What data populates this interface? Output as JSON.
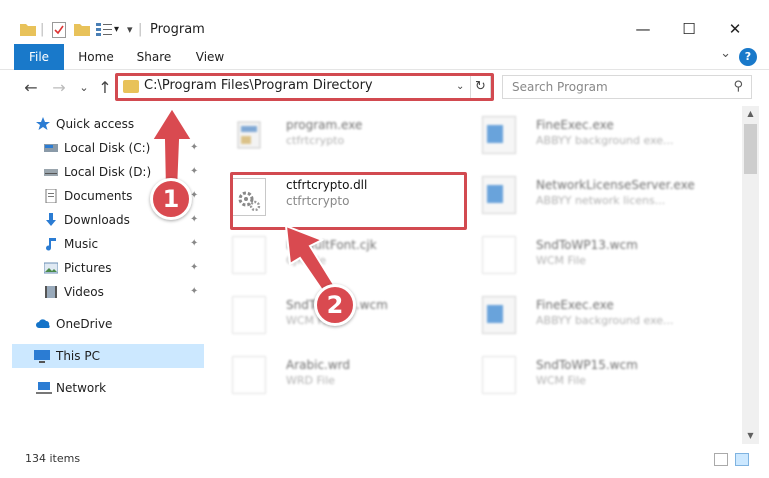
{
  "window": {
    "title": "Program",
    "minimize": "—",
    "maximize": "☐",
    "close": "✕"
  },
  "quick_access_toolbar": {
    "dropdown": "▾"
  },
  "ribbon": {
    "tabs": [
      {
        "label": "File"
      },
      {
        "label": "Home"
      },
      {
        "label": "Share"
      },
      {
        "label": "View"
      }
    ],
    "expand": "⌄",
    "help": "?"
  },
  "navigation": {
    "back": "←",
    "forward": "→",
    "recent": "⌄",
    "up": "↑",
    "address": "C:\\Program Files\\Program Directory",
    "address_dropdown": "⌄",
    "refresh": "↻",
    "search_placeholder": "Search Program"
  },
  "sidebar": {
    "items": [
      {
        "label": "Quick access",
        "icon": "star-icon"
      },
      {
        "label": "Local Disk (C:)",
        "icon": "drive-icon",
        "pinned": true
      },
      {
        "label": "Local Disk (D:)",
        "icon": "drive-icon",
        "pinned": true
      },
      {
        "label": "Documents",
        "icon": "documents-icon",
        "pinned": true
      },
      {
        "label": "Downloads",
        "icon": "downloads-icon",
        "pinned": true
      },
      {
        "label": "Music",
        "icon": "music-icon",
        "pinned": true
      },
      {
        "label": "Pictures",
        "icon": "pictures-icon",
        "pinned": true
      },
      {
        "label": "Videos",
        "icon": "videos-icon",
        "pinned": true
      },
      {
        "label": "OneDrive",
        "icon": "onedrive-icon"
      },
      {
        "label": "This PC",
        "icon": "pc-icon",
        "selected": true
      },
      {
        "label": "Network",
        "icon": "network-icon"
      }
    ],
    "pin_glyph": "📌"
  },
  "files": {
    "left": [
      {
        "name": "program.exe",
        "desc": "ctfrtcrypto"
      },
      {
        "name": "ctfrtcrypto.dll",
        "desc": "ctfrtcrypto"
      },
      {
        "name": "DefaultFont.cjk",
        "desc": "CJK File"
      },
      {
        "name": "SndToWP11.wcm",
        "desc": "WCM File"
      },
      {
        "name": "Arabic.wrd",
        "desc": "WRD File"
      }
    ],
    "right": [
      {
        "name": "FineExec.exe",
        "desc": "ABBYY background exe..."
      },
      {
        "name": "NetworkLicenseServer.exe",
        "desc": "ABBYY network licens..."
      },
      {
        "name": "SndToWP13.wcm",
        "desc": "WCM File"
      },
      {
        "name": "FineExec.exe",
        "desc": "ABBYY background exe..."
      },
      {
        "name": "SndToWP15.wcm",
        "desc": "WCM File"
      }
    ]
  },
  "status": {
    "item_count": "134 items"
  },
  "annotations": {
    "step1": "1",
    "step2": "2",
    "highlight_color": "#d24a50"
  },
  "colors": {
    "accent": "#1979ca",
    "selection": "#cce8ff",
    "folder": "#e8c25a"
  }
}
